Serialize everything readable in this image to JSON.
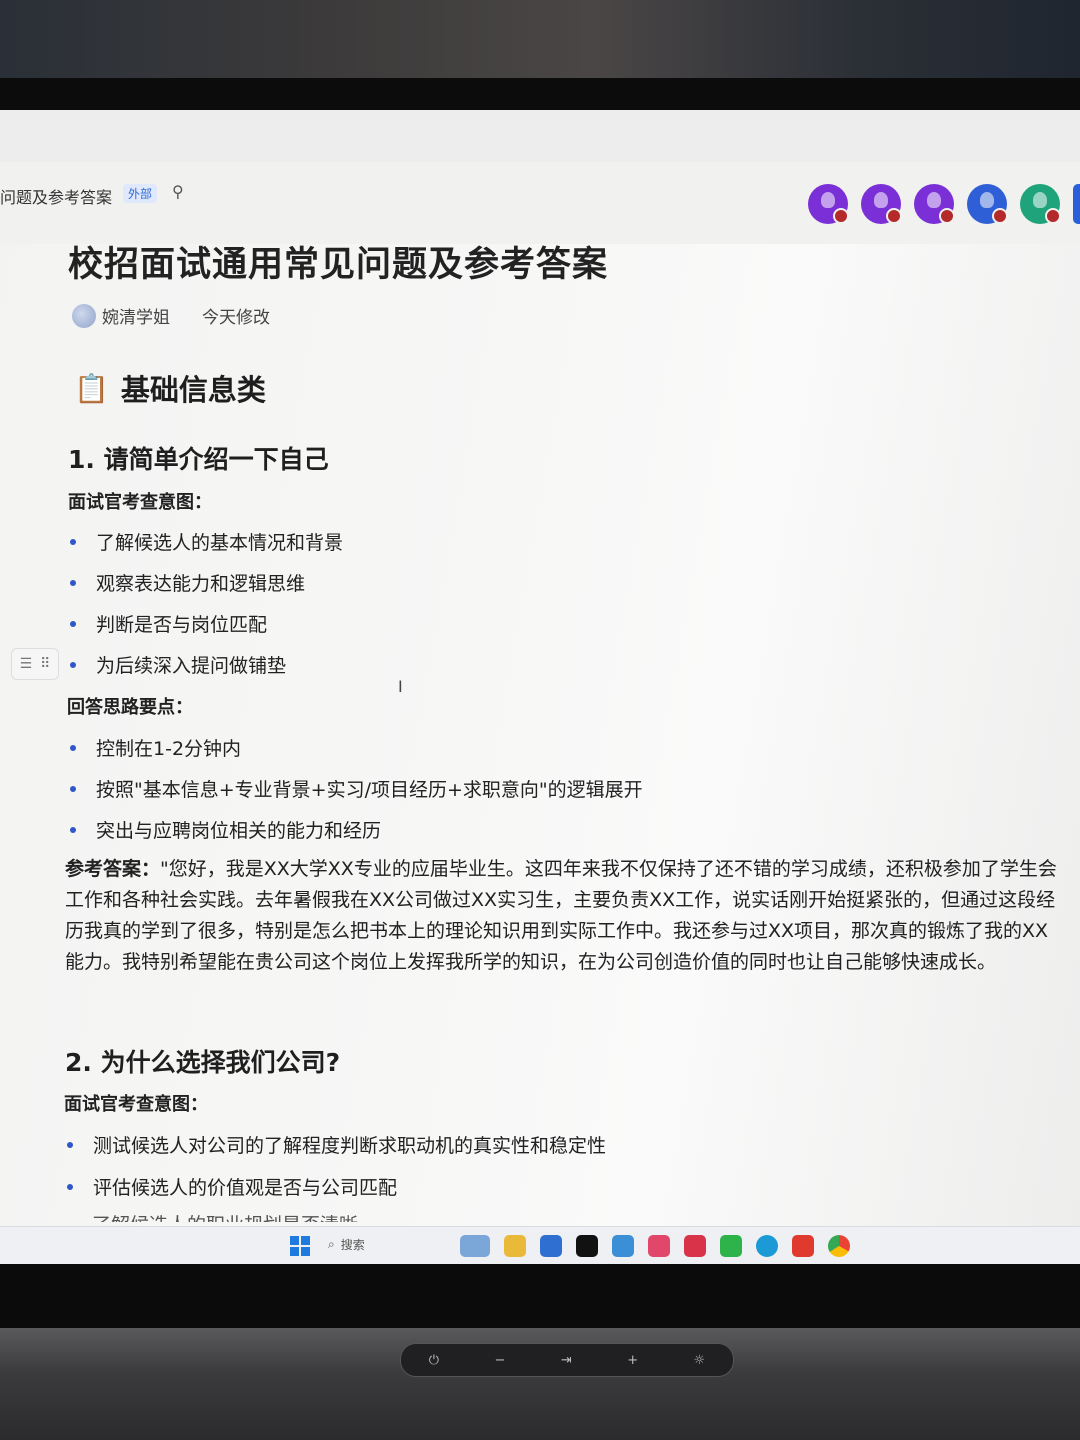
{
  "header": {
    "doc_tab_title": "问题及参考答案",
    "badge": "外部",
    "pin_icon": "pin-icon"
  },
  "avatars": [
    {
      "color": "#7b2fd6"
    },
    {
      "color": "#7b2fd6"
    },
    {
      "color": "#7b2fd6"
    },
    {
      "color": "#2f5fd6"
    },
    {
      "color": "#1fa37a"
    }
  ],
  "doc": {
    "title": "校招面试通用常见问题及参考答案",
    "author": "婉清学姐",
    "modified": "今天修改",
    "section_icon": "clipboard-icon",
    "section_title": "基础信息类",
    "q1": {
      "title": "1. 请简单介绍一下自己",
      "intent_label": "面试官考查意图：",
      "intent_items": [
        "了解候选人的基本情况和背景",
        "观察表达能力和逻辑思维",
        "判断是否与岗位匹配",
        "为后续深入提问做铺垫"
      ],
      "tips_label": "回答思路要点：",
      "tips_items": [
        "控制在1-2分钟内",
        "按照\"基本信息+专业背景+实习/项目经历+求职意向\"的逻辑展开",
        "突出与应聘岗位相关的能力和经历"
      ],
      "answer_label": "参考答案：",
      "answer_text": "\"您好，我是XX大学XX专业的应届毕业生。这四年来我不仅保持了还不错的学习成绩，还积极参加了学生会工作和各种社会实践。去年暑假我在XX公司做过XX实习生，主要负责XX工作，说实话刚开始挺紧张的，但通过这段经历我真的学到了很多，特别是怎么把书本上的理论知识用到实际工作中。我还参与过XX项目，那次真的锻炼了我的XX能力。我特别希望能在贵公司这个岗位上发挥我所学的知识，在为公司创造价值的同时也让自己能够快速成长。"
    },
    "q2": {
      "title": "2. 为什么选择我们公司?",
      "intent_label": "面试官考查意图：",
      "intent_items": [
        "测试候选人对公司的了解程度判断求职动机的真实性和稳定性",
        "评估候选人的价值观是否与公司匹配"
      ],
      "cut_line": "了解候选人的职业规划是否清晰"
    }
  },
  "taskbar": {
    "search_label": "搜索"
  }
}
